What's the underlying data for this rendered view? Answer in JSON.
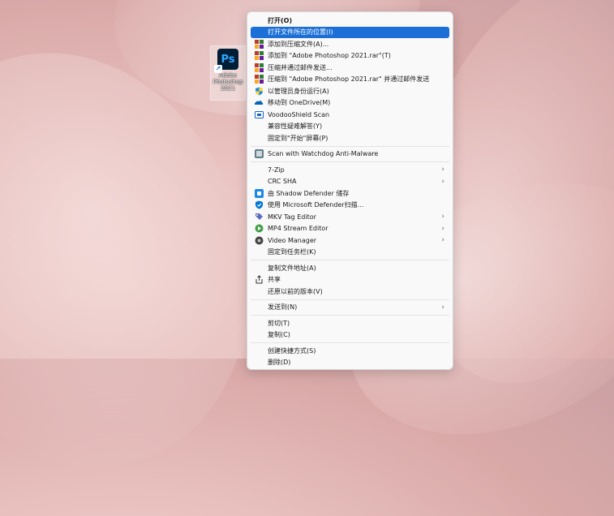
{
  "desktop": {
    "icon_title": "Adobe Photoshop 2021",
    "icon_glyph": "Ps"
  },
  "menu": {
    "items": [
      {
        "label": "打开(O)",
        "icon": "none",
        "bold": true
      },
      {
        "label": "打开文件所在的位置(I)",
        "icon": "none",
        "highlight": true
      },
      {
        "label": "添加到压缩文件(A)...",
        "icon": "winrar-icon"
      },
      {
        "label": "添加到 \"Adobe Photoshop 2021.rar\"(T)",
        "icon": "winrar-icon"
      },
      {
        "label": "压缩并通过邮件发送...",
        "icon": "winrar-icon"
      },
      {
        "label": "压缩到 \"Adobe Photoshop 2021.rar\" 并通过邮件发送",
        "icon": "winrar-icon"
      },
      {
        "label": "以管理员身份运行(A)",
        "icon": "uac-shield-icon"
      },
      {
        "label": "移动到 OneDrive(M)",
        "icon": "onedrive-icon"
      },
      {
        "label": "VoodooShield Scan",
        "icon": "voodooshield-icon"
      },
      {
        "label": "兼容性疑难解答(Y)",
        "icon": "none"
      },
      {
        "label": "固定到\"开始\"屏幕(P)",
        "icon": "none"
      },
      {
        "separator": true
      },
      {
        "label": "Scan with Watchdog Anti-Malware",
        "icon": "watchdog-icon"
      },
      {
        "separator": true
      },
      {
        "label": "7-Zip",
        "icon": "none",
        "submenu": true
      },
      {
        "label": "CRC SHA",
        "icon": "none",
        "submenu": true
      },
      {
        "label": "由 Shadow Defender 储存",
        "icon": "shadow-defender-icon"
      },
      {
        "label": "使用 Microsoft Defender扫描...",
        "icon": "defender-icon"
      },
      {
        "label": "MKV Tag Editor",
        "icon": "mkv-tag-icon",
        "submenu": true
      },
      {
        "label": "MP4 Stream Editor",
        "icon": "mp4-icon",
        "submenu": true
      },
      {
        "label": "Video Manager",
        "icon": "video-manager-icon",
        "submenu": true
      },
      {
        "label": "固定到任务栏(K)",
        "icon": "none"
      },
      {
        "separator": true
      },
      {
        "label": "复制文件地址(A)",
        "icon": "none"
      },
      {
        "label": "共享",
        "icon": "share-icon"
      },
      {
        "label": "还原以前的版本(V)",
        "icon": "none"
      },
      {
        "separator": true
      },
      {
        "label": "发送到(N)",
        "icon": "none",
        "submenu": true
      },
      {
        "separator": true
      },
      {
        "label": "剪切(T)",
        "icon": "none"
      },
      {
        "label": "复制(C)",
        "icon": "none"
      },
      {
        "separator": true
      },
      {
        "label": "创建快捷方式(S)",
        "icon": "none"
      },
      {
        "label": "删除(D)",
        "icon": "none"
      }
    ]
  },
  "colors": {
    "highlight": "#1c6fd6",
    "menu_bg": "#f9f9f9"
  }
}
